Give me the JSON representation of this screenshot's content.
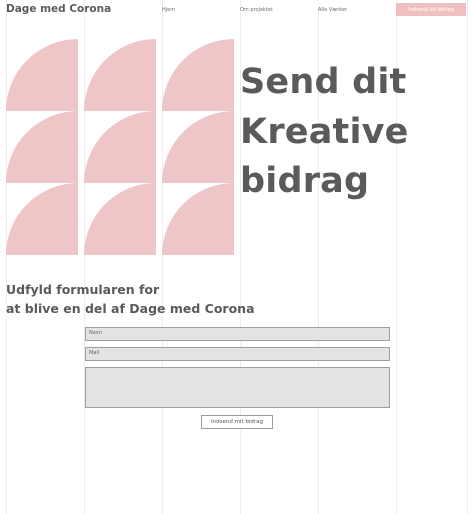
{
  "header": {
    "brand": "Dage med Corona",
    "nav": [
      "Hjem",
      "Om projektet",
      "Alle Værker"
    ],
    "cta_label": "Indsend dit bidrag"
  },
  "hero": {
    "lines": [
      "Send dit",
      "Kreative",
      "bidrag"
    ]
  },
  "form": {
    "intro_lines": [
      "Udfyld formularen for",
      "at blive en del af Dage med Corona"
    ],
    "name_placeholder": "Navn",
    "mail_placeholder": "Mail",
    "submit_label": "Indsend mit bidrag"
  },
  "colors": {
    "accent_pink": "#efc0c2",
    "shape_pink": "#efc6c7",
    "field_bg": "#e3e3e3",
    "text_dark": "#5a5a5a"
  }
}
